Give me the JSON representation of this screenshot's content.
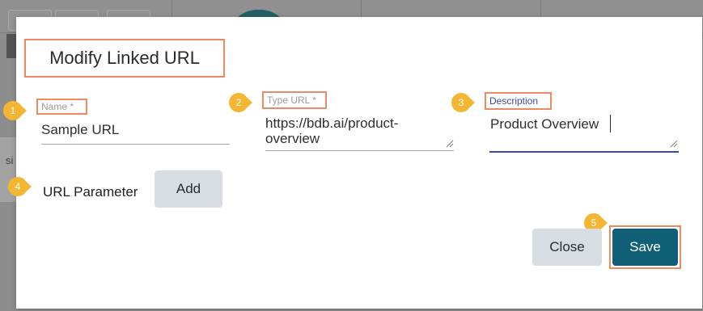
{
  "dialog": {
    "title": "Modify Linked URL"
  },
  "fields": {
    "name": {
      "label": "Name *",
      "value": "Sample URL"
    },
    "type_url": {
      "label": "Type URL *",
      "value_line1": "https://bdb.ai/product-",
      "value_line2": "overview"
    },
    "description": {
      "label": "Description",
      "value": "Product Overview"
    }
  },
  "url_parameter": {
    "label": "URL Parameter",
    "add_label": "Add"
  },
  "actions": {
    "close_label": "Close",
    "save_label": "Save"
  },
  "callouts": [
    "1",
    "2",
    "3",
    "4",
    "5"
  ],
  "background": {
    "partial_label": "si"
  },
  "colors": {
    "callout_fill": "#f2b632",
    "highlight_border": "#ec8a63",
    "save_button": "#0f5f77",
    "focus_underline": "#3d4aab"
  }
}
